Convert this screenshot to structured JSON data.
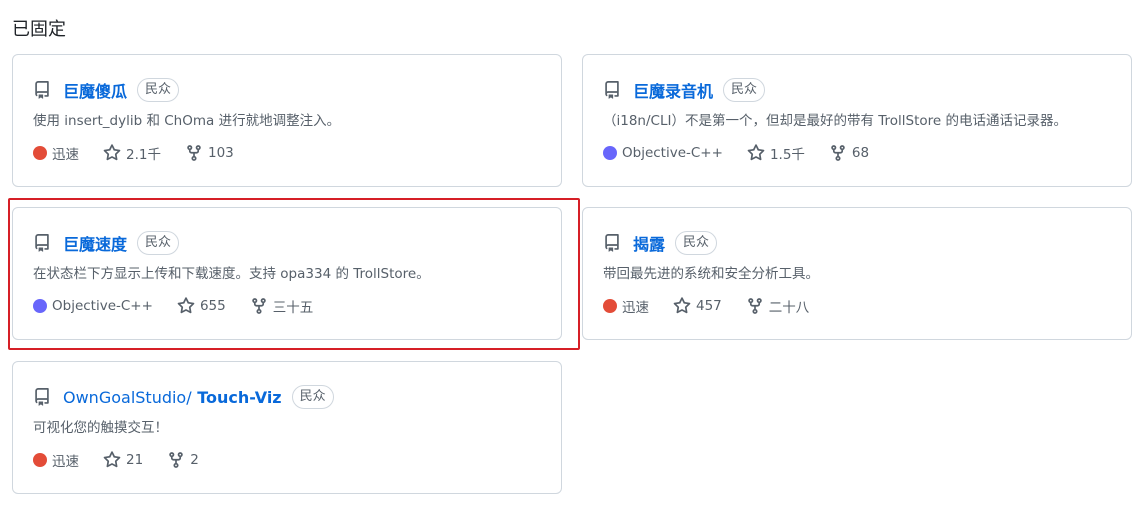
{
  "section": {
    "title": "已固定"
  },
  "repos": [
    {
      "owner": "",
      "name": "巨魔傻瓜",
      "badge": "民众",
      "description": "使用 insert_dylib 和 ChOma 进行就地调整注入。",
      "language": "迅速",
      "language_color": "#e34c38",
      "stars": "2.1千",
      "forks": "103"
    },
    {
      "owner": "",
      "name": "巨魔录音机",
      "badge": "民众",
      "description": "（i18n/CLI）不是第一个，但却是最好的带有 TrollStore 的电话通话记录器。",
      "language": "Objective-C++",
      "language_color": "#6866fb",
      "stars": "1.5千",
      "forks": "68"
    },
    {
      "owner": "",
      "name": "巨魔速度",
      "badge": "民众",
      "description": "在状态栏下方显示上传和下载速度。支持 opa334 的 TrollStore。",
      "language": "Objective-C++",
      "language_color": "#6866fb",
      "stars": "655",
      "forks": "三十五"
    },
    {
      "owner": "",
      "name": "揭露",
      "badge": "民众",
      "description": "带回最先进的系统和安全分析工具。",
      "language": "迅速",
      "language_color": "#e34c38",
      "stars": "457",
      "forks": "二十八"
    },
    {
      "owner": "OwnGoalStudio/",
      "name": "Touch-Viz",
      "badge": "民众",
      "description": "可视化您的触摸交互！",
      "language": "迅速",
      "language_color": "#e34c38",
      "stars": "21",
      "forks": "2"
    }
  ]
}
